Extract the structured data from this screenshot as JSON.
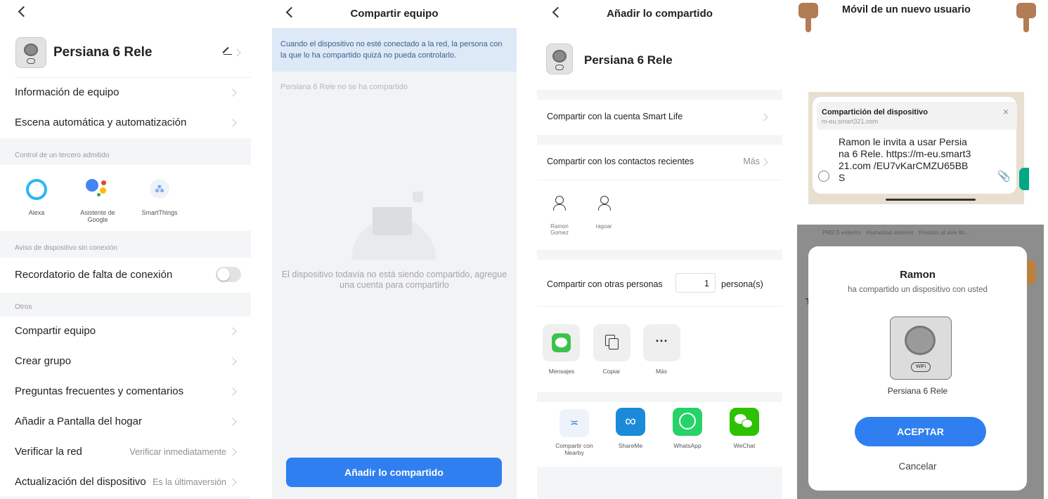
{
  "panel1": {
    "device_name": "Persiana 6 Rele",
    "rows": [
      {
        "label": "Información de equipo"
      },
      {
        "label": "Escena automática y automatización"
      }
    ],
    "section_third_party": "Control de un tercero admitido",
    "third_party": [
      {
        "label": "Alexa",
        "icon": "alexa-icon"
      },
      {
        "label": "Asistente de Google",
        "icon": "google-assistant-icon"
      },
      {
        "label": "SmartThings",
        "icon": "smartthings-icon"
      }
    ],
    "section_offline": "Aviso de dispositivo sin conexión",
    "offline_reminder": "Recordatorio de falta de conexión",
    "section_others": "Otros",
    "others": [
      {
        "label": "Compartir equipo",
        "value": ""
      },
      {
        "label": "Crear grupo",
        "value": ""
      },
      {
        "label": "Preguntas frecuentes y comentarios",
        "value": ""
      },
      {
        "label": "Añadir a Pantalla del hogar",
        "value": ""
      },
      {
        "label": "Verificar la red",
        "value": "Verificar inmediatamente"
      },
      {
        "label": "Actualización del dispositivo",
        "value": "Es la últimaversión"
      }
    ]
  },
  "panel2": {
    "title": "Compartir equipo",
    "notice": "Cuando el dispositivo no esté conectado a la red, la persona con la que lo ha compartido quizá no pueda controlarlo.",
    "not_shared": "Persiana 6 Rele no se ha compartido",
    "empty_message": "El dispositivo todavía no está siendo compartido, agregue una cuenta para compartirlo",
    "button": "Añadir lo compartido"
  },
  "panel3": {
    "title": "Añadir lo compartido",
    "device_name": "Persiana 6 Rele",
    "share_account": "Compartir con la cuenta Smart Life",
    "share_recent": "Compartir con los contactos recientes",
    "more": "Más",
    "contacts": [
      {
        "name": "Ramon Gomez"
      },
      {
        "name": "ragoar"
      }
    ],
    "share_others": "Compartir con otras personas",
    "persons_count": "1",
    "persons_unit": "persona(s)",
    "apps_row1": [
      {
        "label": "Mensajes",
        "icon": "messages-icon"
      },
      {
        "label": "Copiar",
        "icon": "copy-icon"
      },
      {
        "label": "Más",
        "icon": "more-icon"
      }
    ],
    "apps_row2": [
      {
        "label": "Compartir con Nearby",
        "icon": "nearby-icon"
      },
      {
        "label": "ShareMe",
        "icon": "shareme-icon"
      },
      {
        "label": "WhatsApp",
        "icon": "whatsapp-icon"
      },
      {
        "label": "WeChat",
        "icon": "wechat-icon"
      }
    ]
  },
  "panel4": {
    "heading": "Móvil de un nuevo usuario",
    "notif_title": "Compartición del dispositivo",
    "notif_domain": "m-eu.smart321.com",
    "message": "Ramon le invita a usar Persiana 6 Rele. https://m-eu.smart321.com /EU7vKarCMZU65BBS",
    "bg_header": "PM2.5 exterior   Humedad exterior   Presión al aire lib...",
    "bg_text": "To",
    "dialog_name": "Ramon",
    "dialog_sub": "ha compartido un dispositivo con usted",
    "dialog_device": "Persiana 6 Rele",
    "accept": "ACEPTAR",
    "cancel": "Cancelar"
  },
  "colors": {
    "accent": "#2f7ff0",
    "notice_bg": "#dde9f7",
    "whatsapp": "#25d366",
    "wechat": "#2dc100"
  }
}
